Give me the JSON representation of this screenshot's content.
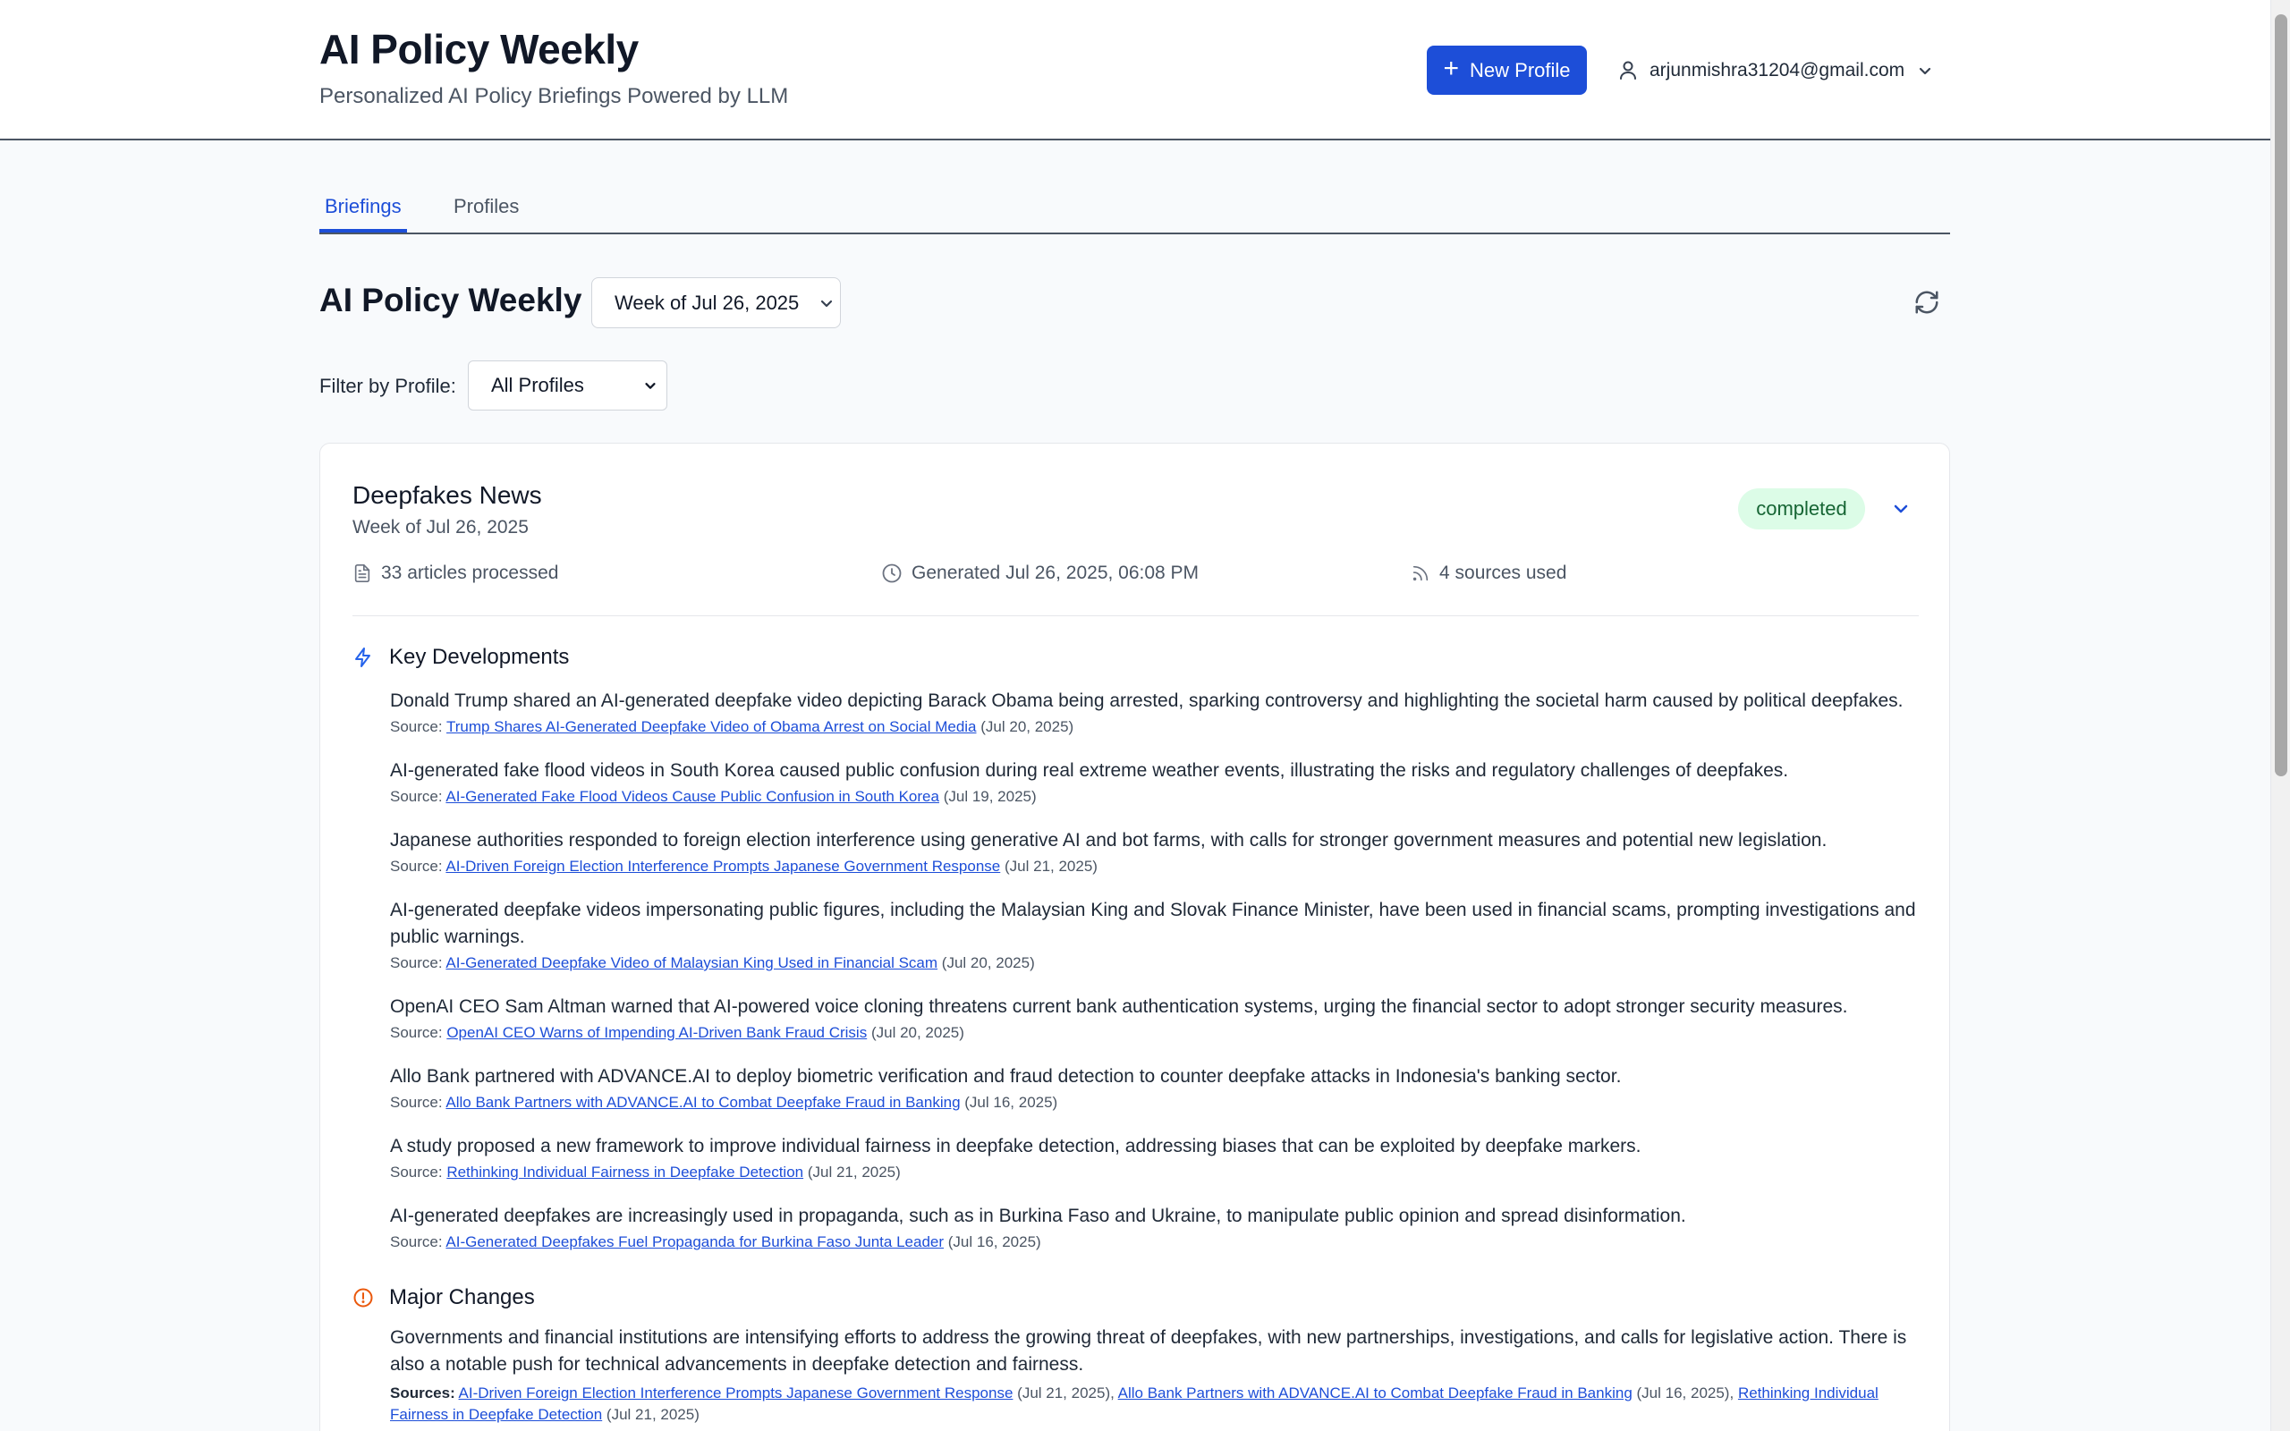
{
  "header": {
    "title": "AI Policy Weekly",
    "subtitle": "Personalized AI Policy Briefings Powered by LLM",
    "new_profile_label": "New Profile",
    "user_email": "arjunmishra31204@gmail.com"
  },
  "tabs": [
    {
      "label": "Briefings",
      "active": true
    },
    {
      "label": "Profiles",
      "active": false
    }
  ],
  "main": {
    "title": "AI Policy Weekly",
    "week_selected": "Week of Jul 26, 2025",
    "filter_label": "Filter by Profile:",
    "filter_value": "All Profiles"
  },
  "briefing": {
    "title": "Deepfakes News",
    "week": "Week of Jul 26, 2025",
    "status": "completed",
    "articles": "33 articles processed",
    "generated": "Generated Jul 26, 2025, 06:08 PM",
    "sources": "4 sources used",
    "key_developments_label": "Key Developments",
    "source_prefix": "Source:",
    "developments": [
      {
        "text": "Donald Trump shared an AI-generated deepfake video depicting Barack Obama being arrested, sparking controversy and highlighting the societal harm caused by political deepfakes.",
        "link": "Trump Shares AI-Generated Deepfake Video of Obama Arrest on Social Media",
        "date": "(Jul 20, 2025)"
      },
      {
        "text": "AI-generated fake flood videos in South Korea caused public confusion during real extreme weather events, illustrating the risks and regulatory challenges of deepfakes.",
        "link": "AI-Generated Fake Flood Videos Cause Public Confusion in South Korea",
        "date": "(Jul 19, 2025)"
      },
      {
        "text": "Japanese authorities responded to foreign election interference using generative AI and bot farms, with calls for stronger government measures and potential new legislation.",
        "link": "AI-Driven Foreign Election Interference Prompts Japanese Government Response",
        "date": "(Jul 21, 2025)"
      },
      {
        "text": "AI-generated deepfake videos impersonating public figures, including the Malaysian King and Slovak Finance Minister, have been used in financial scams, prompting investigations and public warnings.",
        "link": "AI-Generated Deepfake Video of Malaysian King Used in Financial Scam",
        "date": "(Jul 20, 2025)"
      },
      {
        "text": "OpenAI CEO Sam Altman warned that AI-powered voice cloning threatens current bank authentication systems, urging the financial sector to adopt stronger security measures.",
        "link": "OpenAI CEO Warns of Impending AI-Driven Bank Fraud Crisis",
        "date": "(Jul 20, 2025)"
      },
      {
        "text": "Allo Bank partnered with ADVANCE.AI to deploy biometric verification and fraud detection to counter deepfake attacks in Indonesia's banking sector.",
        "link": "Allo Bank Partners with ADVANCE.AI to Combat Deepfake Fraud in Banking",
        "date": "(Jul 16, 2025)"
      },
      {
        "text": "A study proposed a new framework to improve individual fairness in deepfake detection, addressing biases that can be exploited by deepfake markers.",
        "link": "Rethinking Individual Fairness in Deepfake Detection",
        "date": "(Jul 21, 2025)"
      },
      {
        "text": "AI-generated deepfakes are increasingly used in propaganda, such as in Burkina Faso and Ukraine, to manipulate public opinion and spread disinformation.",
        "link": "AI-Generated Deepfakes Fuel Propaganda for Burkina Faso Junta Leader",
        "date": "(Jul 16, 2025)"
      }
    ],
    "major_changes_label": "Major Changes",
    "major_changes_text": "Governments and financial institutions are intensifying efforts to address the growing threat of deepfakes, with new partnerships, investigations, and calls for legislative action. There is also a notable push for technical advancements in deepfake detection and fairness.",
    "sources_prefix": "Sources:",
    "major_changes_sources": [
      {
        "link": "AI-Driven Foreign Election Interference Prompts Japanese Government Response",
        "date": "(Jul 21, 2025),"
      },
      {
        "link": "Allo Bank Partners with ADVANCE.AI to Combat Deepfake Fraud in Banking",
        "date": "(Jul 16, 2025),"
      },
      {
        "link": "Rethinking Individual Fairness in Deepfake Detection",
        "date": "(Jul 21, 2025)"
      }
    ]
  },
  "colors": {
    "accent": "#1d4ed8",
    "status_bg": "#dcfce7",
    "status_text": "#166534",
    "warning": "#ea580c"
  },
  "icons": [
    "plus-icon",
    "user-icon",
    "chevron-down-icon",
    "refresh-icon",
    "document-icon",
    "clock-icon",
    "rss-icon",
    "lightning-icon",
    "alert-circle-icon"
  ]
}
